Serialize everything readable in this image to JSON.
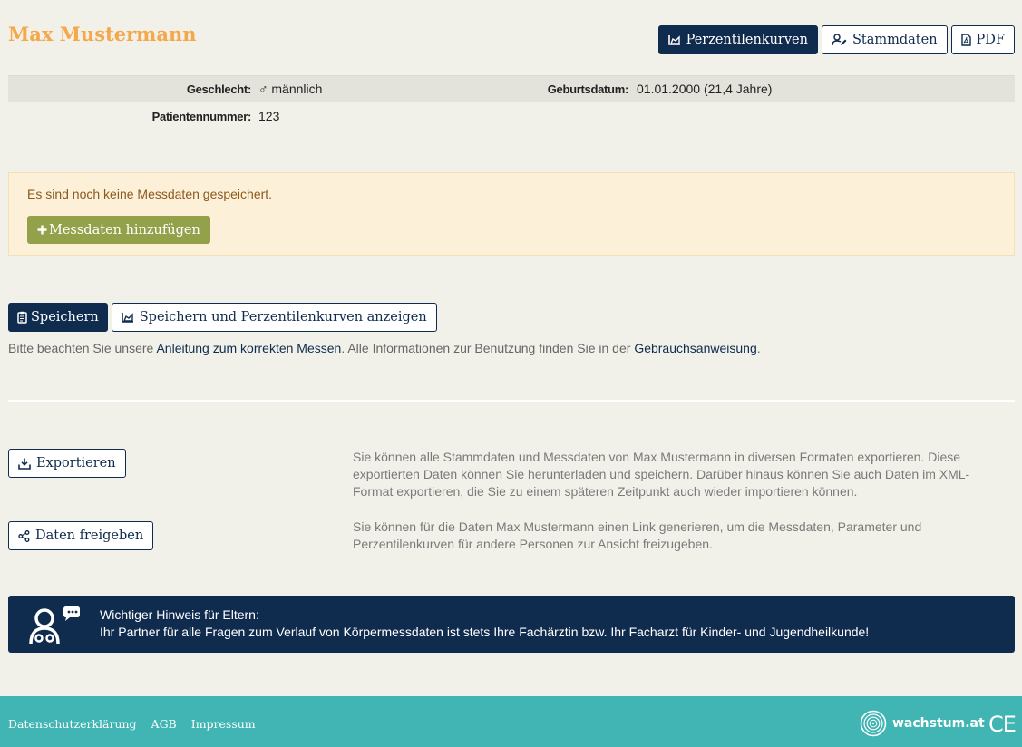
{
  "header": {
    "title": "Max Mustermann",
    "buttons": {
      "percentile": "Perzentilenkurven",
      "master_data": "Stammdaten",
      "pdf": "PDF"
    }
  },
  "patient": {
    "gender_label": "Geschlecht:",
    "gender_symbol": "♂",
    "gender_value": "männlich",
    "birthdate_label": "Geburtsdatum:",
    "birthdate_value": "01.01.2000 (21,4 Jahre)",
    "patient_number_label": "Patientennummer:",
    "patient_number_value": "123"
  },
  "alert": {
    "text": "Es sind noch keine Messdaten gespeichert.",
    "add_button": "Messdaten hinzufügen"
  },
  "save": {
    "save_button": "Speichern",
    "save_and_show_button": "Speichern und Perzentilenkurven anzeigen"
  },
  "hint": {
    "prefix": "Bitte beachten Sie unsere ",
    "link1": "Anleitung zum korrekten Messen",
    "middle": ". Alle Informationen zur Benutzung finden Sie in der ",
    "link2": "Gebrauchsanweisung",
    "suffix": "."
  },
  "export": {
    "button": "Exportieren",
    "description": "Sie können alle Stammdaten und Messdaten von Max Mustermann in diversen Formaten exportieren. Diese exportierten Daten können Sie herunterladen und speichern. Darüber hinaus können Sie auch Daten im XML-Format exportieren, die Sie zu einem späteren Zeitpunkt auch wieder importieren können."
  },
  "share": {
    "button": "Daten freigeben",
    "description": "Sie können für die Daten Max Mustermann einen Link generieren, um die Messdaten, Parameter und Perzentilenkurven für andere Personen zur Ansicht freizugeben."
  },
  "notice": {
    "title": "Wichtiger Hinweis für Eltern:",
    "body": "Ihr Partner für alle Fragen zum Verlauf von Körpermessdaten ist stets Ihre Fachärztin bzw. Ihr Facharzt für Kinder- und Jugendheilkunde!"
  },
  "footer": {
    "links": [
      "Datenschutzerklärung",
      "AGB",
      "Impressum"
    ],
    "brand": "wachstum.at",
    "ce_mark": "CE"
  },
  "colors": {
    "navy": "#0f2b4e",
    "orange_title": "#f5a84a",
    "olive_button": "#93a24a",
    "teal_footer": "#41b4b4",
    "alert_bg": "#fdf0d8"
  }
}
